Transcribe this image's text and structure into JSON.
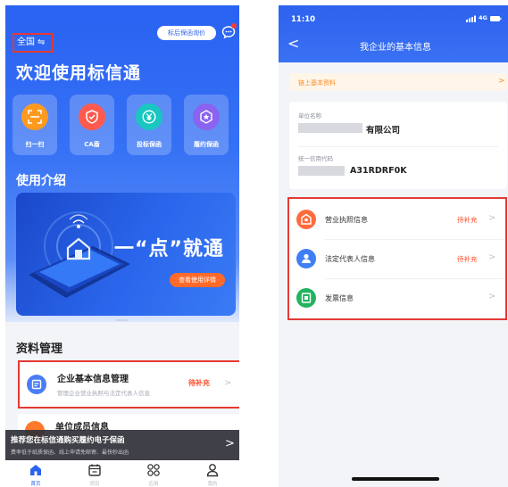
{
  "left": {
    "region": "全国",
    "region_swap_symbol": "⇋",
    "inquiry_button": "标后保函询价",
    "welcome": "欢迎使用标信通",
    "quick_actions": [
      {
        "label": "扫一扫",
        "icon": "scan-icon",
        "color": "#ff9a1f"
      },
      {
        "label": "CA盾",
        "icon": "shield-icon",
        "color": "#ff5a4d"
      },
      {
        "label": "投标保函",
        "icon": "yuan-icon",
        "color": "#19c6c0"
      },
      {
        "label": "履约保函",
        "icon": "badge-icon",
        "color": "#8a63f0"
      }
    ],
    "intro_title": "使用介绍",
    "banner": {
      "slogan": "一“点”就通",
      "button": "查看使用详情"
    },
    "section_title": "资料管理",
    "enterprise_card": {
      "title": "企业基本信息管理",
      "subtitle": "管理企业营业执照与法定代表人信息",
      "status": "待补充",
      "chevron": ">"
    },
    "member_card": {
      "title": "单位成员信息"
    },
    "promo": {
      "title": "推荐您在标信通购买履约电子保函",
      "subtitle": "费率低于纸质保函、线上申请免邮寄、最快秒出函",
      "arrow": ">"
    },
    "tabs": [
      {
        "label": "首页",
        "icon": "home-icon",
        "active": true
      },
      {
        "label": "项目",
        "icon": "calendar-icon",
        "active": false
      },
      {
        "label": "应用",
        "icon": "apps-icon",
        "active": false
      },
      {
        "label": "我的",
        "icon": "user-icon",
        "active": false
      }
    ],
    "colors": {
      "primary": "#2a62f2",
      "alert_border": "#e53935",
      "status": "#ff4d2a"
    }
  },
  "right": {
    "time": "11:10",
    "network": "4G",
    "back": "<",
    "title": "我企业的基本信息",
    "note": {
      "text": "链上基本资料",
      "chevron": ">"
    },
    "company": {
      "name_label": "单位名称",
      "name_value": "有限公司",
      "credit_label": "统一信用代码",
      "credit_value": "A31RDRF0K"
    },
    "items": [
      {
        "name": "营业执照信息",
        "status": "待补充",
        "icon": "license-icon",
        "color": "#ff6b3d"
      },
      {
        "name": "法定代表人信息",
        "status": "待补充",
        "icon": "person-icon",
        "color": "#3f7ff6"
      },
      {
        "name": "发票信息",
        "status": "",
        "icon": "invoice-icon",
        "color": "#22b35e"
      }
    ]
  }
}
